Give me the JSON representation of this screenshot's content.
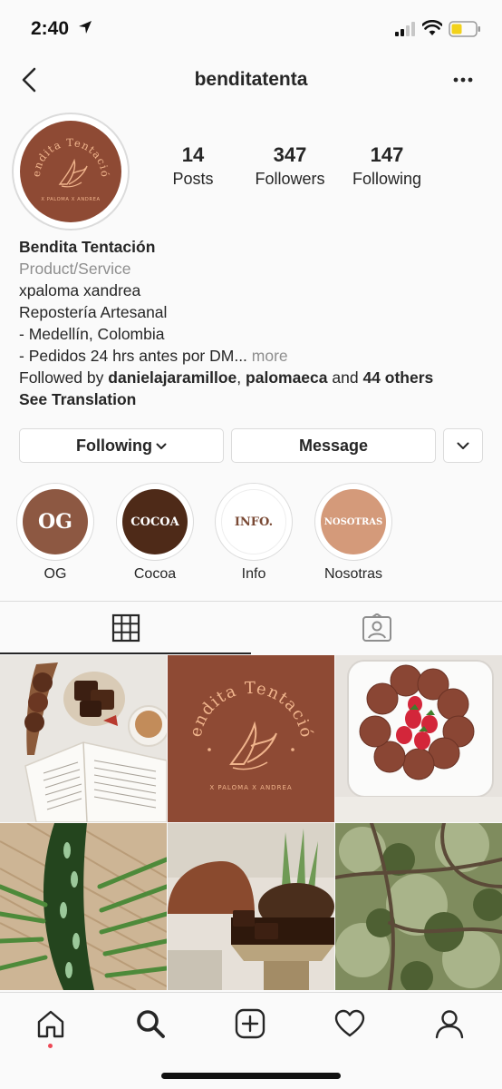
{
  "status": {
    "time": "2:40"
  },
  "header": {
    "username": "benditatenta"
  },
  "profile": {
    "avatar_text": "Bendita Tentación",
    "avatar_subtext": "X PALOMA X ANDREA",
    "stats": [
      {
        "value": "14",
        "label": "Posts"
      },
      {
        "value": "347",
        "label": "Followers"
      },
      {
        "value": "147",
        "label": "Following"
      }
    ]
  },
  "bio": {
    "name": "Bendita Tentación",
    "category": "Product/Service",
    "lines": [
      "xpaloma xandrea",
      "Repostería Artesanal",
      "- Medellín, Colombia"
    ],
    "truncated_line": "- Pedidos 24 hrs antes por DM...",
    "more_label": "more",
    "followed_by_prefix": "Followed by",
    "followed_by_user1": "danielajaramilloe",
    "followed_by_user2": "palomaeca",
    "followed_by_and": "and",
    "followed_by_others": "44 others",
    "see_translation": "See Translation"
  },
  "buttons": {
    "following": "Following",
    "message": "Message"
  },
  "highlights": [
    {
      "label": "OG",
      "cover_text": "OG",
      "color": "#8d5842",
      "text_color": "#ffffff"
    },
    {
      "label": "Cocoa",
      "cover_text": "COCOA",
      "color": "#4e2a18",
      "text_color": "#ffffff"
    },
    {
      "label": "Info",
      "cover_text": "INFO.",
      "color": "#ffffff",
      "text_color": "#7a4a35"
    },
    {
      "label": "Nosotras",
      "cover_text": "NOSOTRAS",
      "color": "#d49a7a",
      "text_color": "#ffffff"
    }
  ],
  "tabs": {
    "grid_icon": "grid-icon",
    "tagged_icon": "tagged-icon"
  },
  "posts": [
    {
      "name": "post-brownies-book"
    },
    {
      "name": "post-logo",
      "text": "Bendita Tentación",
      "subtext": "X PALOMA X ANDREA"
    },
    {
      "name": "post-cookies-plate"
    },
    {
      "name": "post-palm-leaves"
    },
    {
      "name": "post-brownie-pedestal"
    },
    {
      "name": "post-tree-branches"
    }
  ],
  "nav": [
    "home-icon",
    "search-icon",
    "add-post-icon",
    "heart-icon",
    "profile-icon"
  ],
  "colors": {
    "brand_brown": "#8e4a34",
    "accent_peach": "#f0b48c",
    "border": "#dbdbdb",
    "muted_text": "#8e8e8e",
    "notification": "#ed4956"
  }
}
